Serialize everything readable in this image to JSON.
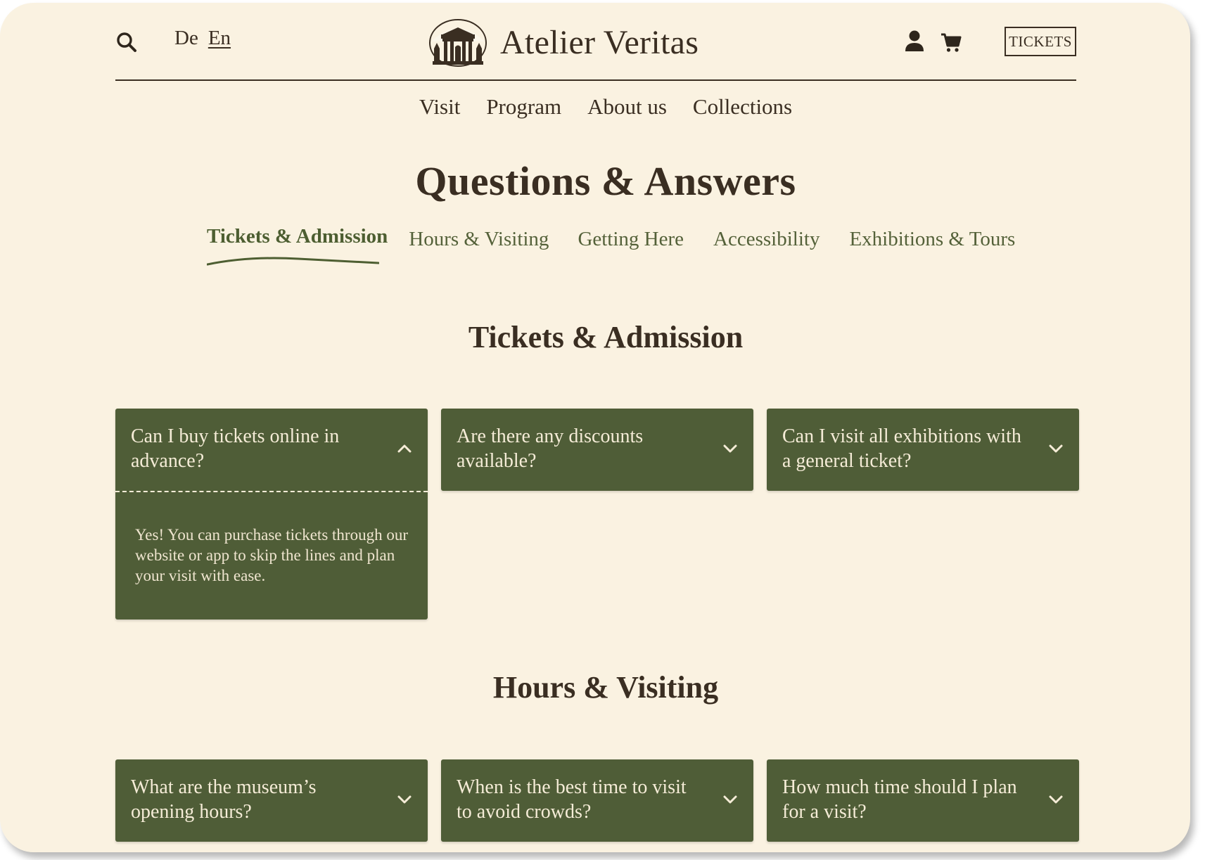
{
  "header": {
    "languages": [
      "De",
      "En"
    ],
    "active_language": "En",
    "brand": "Atelier Veritas",
    "tickets_label": "TICKETS"
  },
  "nav": [
    "Visit",
    "Program",
    "About us",
    "Collections"
  ],
  "page_title": "Questions & Answers",
  "tabs": [
    {
      "label": "Tickets & Admission",
      "active": true
    },
    {
      "label": "Hours & Visiting",
      "active": false
    },
    {
      "label": "Getting Here",
      "active": false
    },
    {
      "label": "Accessibility",
      "active": false
    },
    {
      "label": "Exhibitions & Tours",
      "active": false
    }
  ],
  "sections": [
    {
      "title": "Tickets & Admission",
      "faqs": [
        {
          "question": "Can I buy tickets online in advance?",
          "expanded": true,
          "answer": "Yes! You can purchase tickets through our website or app to skip the lines and plan your visit with ease."
        },
        {
          "question": "Are there any discounts available?",
          "expanded": false
        },
        {
          "question": "Can I visit all exhibitions with a general ticket?",
          "expanded": false
        }
      ]
    },
    {
      "title": "Hours & Visiting",
      "faqs": [
        {
          "question": "What are the museum’s opening hours?",
          "expanded": false
        },
        {
          "question": "When is the best time to visit to avoid crowds?",
          "expanded": false
        },
        {
          "question": "How much time should I plan for a visit?",
          "expanded": false
        }
      ]
    }
  ],
  "colors": {
    "background": "#faf2e1",
    "card": "#4f5d37",
    "text": "#3a2e22",
    "accent": "#4d5e31"
  },
  "icons": [
    "search-icon",
    "user-icon",
    "cart-icon",
    "chevron-up-icon",
    "chevron-down-icon"
  ]
}
